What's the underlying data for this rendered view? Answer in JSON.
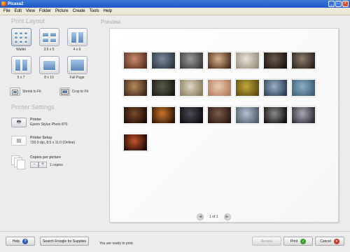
{
  "window": {
    "title": "Picasa2"
  },
  "menu": [
    "File",
    "Edit",
    "View",
    "Folder",
    "Picture",
    "Create",
    "Tools",
    "Help"
  ],
  "print_layout": {
    "title": "Print Layout",
    "layouts": [
      {
        "label": "Wallet",
        "icon": "wallet-layout-icon",
        "selected": true
      },
      {
        "label": "3.5 x 5",
        "icon": "layout-3-5x5-icon"
      },
      {
        "label": "4 x 6",
        "icon": "layout-4x6-icon"
      },
      {
        "label": "5 x 7",
        "icon": "layout-5x7-icon"
      },
      {
        "label": "8 x 10",
        "icon": "layout-8x10-icon"
      },
      {
        "label": "Full Page",
        "icon": "full-page-layout-icon"
      }
    ],
    "shrink_label": "Shrink to Fit",
    "crop_label": "Crop to Fit"
  },
  "printer_settings": {
    "title": "Printer Settings",
    "printer_heading": "Printer",
    "printer_name": "Epson Stylus Photo 870",
    "setup_heading": "Printer Setup",
    "setup_value": "720.0 dpi, 8.5 x 11.0 (Online)",
    "copies_heading": "Copies per picture",
    "copies_value": "1 copies",
    "minus_label": "−",
    "plus_label": "+"
  },
  "preview": {
    "title": "Preview",
    "page_indicator": "1 of 1",
    "photo_count": 22
  },
  "status": "You are ready to print.",
  "buttons": {
    "help": "Help",
    "froogle": "Search Froogle for Supplies",
    "review": "Review",
    "print": "Print",
    "cancel": "Cancel"
  },
  "colors": {
    "titlebar": "#1f56c8",
    "help_icon": "#2f5fb3",
    "print_icon": "#3b9a33",
    "cancel_icon": "#c43b2c"
  }
}
